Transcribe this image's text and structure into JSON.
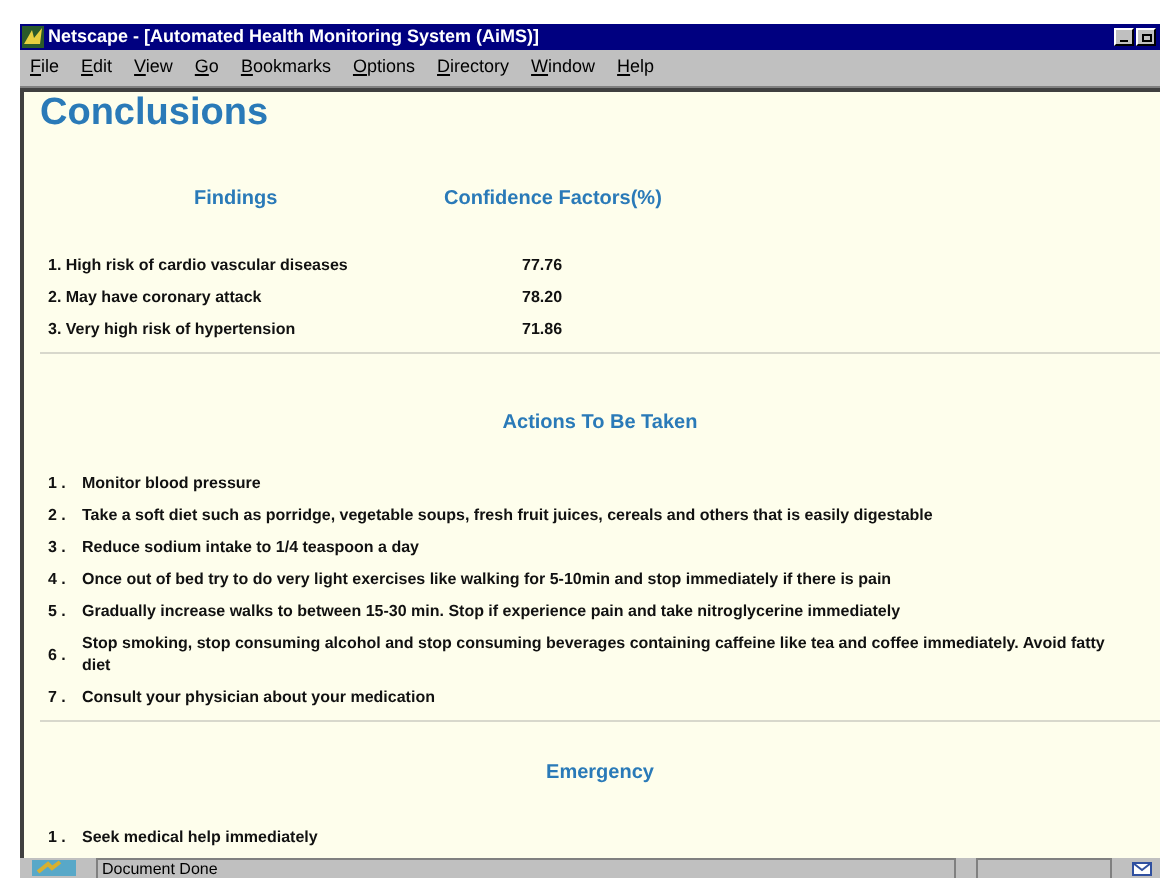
{
  "window": {
    "title": "Netscape - [Automated Health Monitoring System (AiMS)]"
  },
  "menu": [
    "File",
    "Edit",
    "View",
    "Go",
    "Bookmarks",
    "Options",
    "Directory",
    "Window",
    "Help"
  ],
  "page": {
    "heading": "Conclusions",
    "findings": {
      "columns": [
        "Findings",
        "Confidence Factors(%)"
      ],
      "rows": [
        {
          "finding": "1. High risk of cardio vascular diseases",
          "factor": "77.76"
        },
        {
          "finding": "2. May have coronary attack",
          "factor": "78.20"
        },
        {
          "finding": "3. Very high risk of hypertension",
          "factor": "71.86"
        }
      ]
    },
    "actions": {
      "heading": "Actions To Be Taken",
      "items": [
        {
          "number": "1 .",
          "text": "Monitor blood pressure"
        },
        {
          "number": "2 .",
          "text": "Take a soft diet such as porridge, vegetable soups, fresh fruit juices, cereals and others that is easily digestable"
        },
        {
          "number": "3 .",
          "text": "Reduce sodium intake to 1/4 teaspoon a day"
        },
        {
          "number": "4 .",
          "text": "Once out of bed try to do very light exercises like walking for 5-10min and stop immediately if there is pain"
        },
        {
          "number": "5 .",
          "text": "Gradually increase walks to between 15-30 min. Stop if experience pain and take nitroglycerine immediately"
        },
        {
          "number": "6 .",
          "text": "Stop smoking, stop consuming alcohol and stop consuming beverages containing caffeine like tea and coffee immediately. Avoid fatty diet"
        },
        {
          "number": "7 .",
          "text": "Consult your physician about your medication"
        }
      ]
    },
    "emergency": {
      "heading": "Emergency",
      "items": [
        {
          "number": "1 .",
          "text": "Seek medical help immediately"
        }
      ]
    }
  },
  "status_bar": {
    "text": "Document Done"
  }
}
